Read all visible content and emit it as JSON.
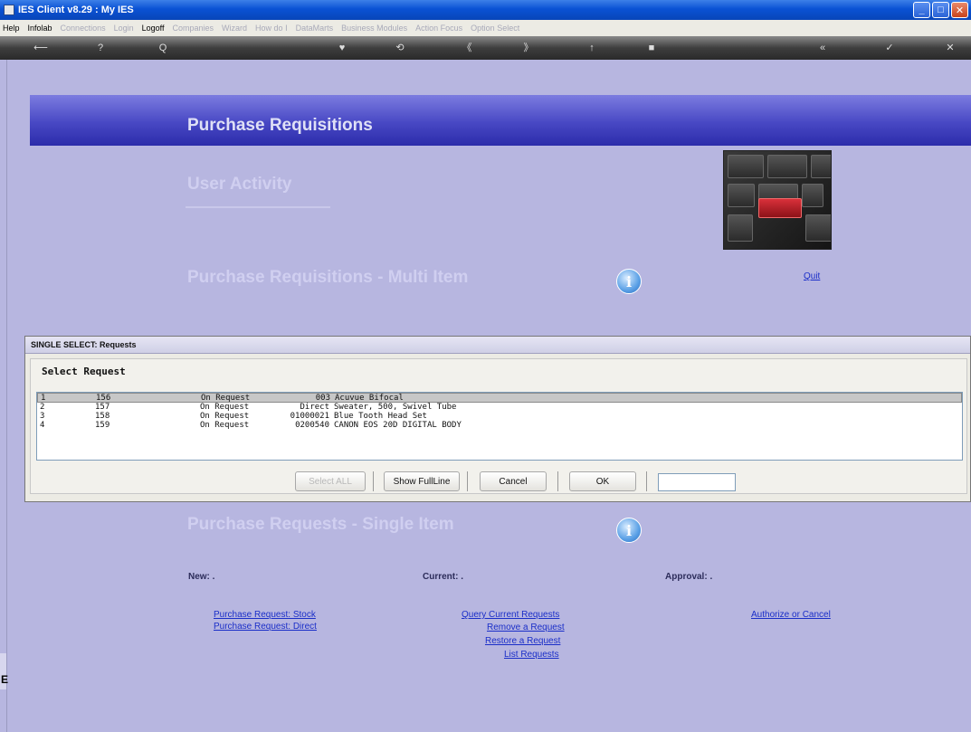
{
  "window": {
    "title": "IES Client v8.29 : My IES",
    "controls": [
      "_",
      "□",
      "✕"
    ]
  },
  "menubar": [
    {
      "label": "Help",
      "enabled": true
    },
    {
      "label": "Infolab",
      "enabled": true
    },
    {
      "label": "Connections",
      "enabled": false
    },
    {
      "label": "Login",
      "enabled": false
    },
    {
      "label": "Logoff",
      "enabled": true
    },
    {
      "label": "Companies",
      "enabled": false
    },
    {
      "label": "Wizard",
      "enabled": false
    },
    {
      "label": "How do I",
      "enabled": false
    },
    {
      "label": "DataMarts",
      "enabled": false
    },
    {
      "label": "Business Modules",
      "enabled": false
    },
    {
      "label": "Action Focus",
      "enabled": false
    },
    {
      "label": "Option Select",
      "enabled": false
    }
  ],
  "toolbar": {
    "icons": [
      "back-arrow-icon",
      "help-icon",
      "search-icon",
      "heart-icon",
      "refresh-icon",
      "rewind-icon",
      "forward-icon",
      "up-icon",
      "stop-icon",
      "dismiss-icon",
      "confirm-icon",
      "close-icon"
    ],
    "glyphs": [
      "⟵",
      "?",
      "Q",
      "♥",
      "⟲",
      "《",
      "》",
      "↑",
      "■",
      "«",
      "✓",
      "✕"
    ]
  },
  "page": {
    "banner_title": "Purchase Requisitions",
    "section_user_activity": "User Activity",
    "section_multi_item": "Purchase Requisitions - Multi Item",
    "quit_link": "Quit",
    "section_single_item": "Purchase Requests - Single Item",
    "new_label": "New: .",
    "current_label": "Current: .",
    "approval_label": "Approval: .",
    "new_links": [
      "Purchase Request: Stock",
      "Purchase Request: Direct"
    ],
    "current_links": [
      "Query Current Requests",
      "Remove a Request",
      "Restore a Request",
      "List Requests"
    ],
    "approval_links": [
      "Authorize or Cancel"
    ],
    "left_strip_glyph": "E"
  },
  "dialog": {
    "title": "SINGLE SELECT: Requests",
    "heading": "Select Request",
    "rows": [
      {
        "num": "1",
        "id": "156",
        "status": "On Request",
        "code": "003",
        "desc": "Acuvue Bifocal",
        "selected": true
      },
      {
        "num": "2",
        "id": "157",
        "status": "On Request",
        "code": "Direct",
        "desc": "Sweater, 500, Swivel Tube",
        "selected": false
      },
      {
        "num": "3",
        "id": "158",
        "status": "On Request",
        "code": "01000021",
        "desc": "Blue Tooth Head Set",
        "selected": false
      },
      {
        "num": "4",
        "id": "159",
        "status": "On Request",
        "code": "0200540",
        "desc": "CANON EOS 20D DIGITAL BODY",
        "selected": false
      }
    ],
    "buttons": {
      "select_all": "Select ALL",
      "show_full_line": "Show FullLine",
      "cancel": "Cancel",
      "ok": "OK"
    },
    "filter_value": ""
  }
}
